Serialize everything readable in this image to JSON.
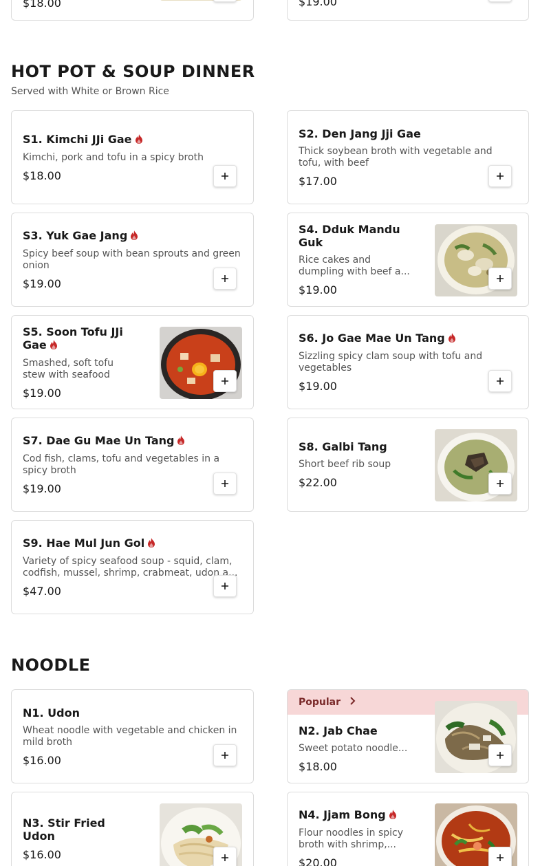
{
  "top_partial": {
    "left_price": "$18.00",
    "right_price": "$19.00"
  },
  "hotpot": {
    "title": "HOT POT & SOUP DINNER",
    "subtitle": "Served with White or Brown Rice",
    "items": [
      {
        "name": "S1. Kimchi JJi Gae",
        "desc": "Kimchi, pork and tofu in a spicy broth",
        "price": "$18.00",
        "spicy": true
      },
      {
        "name": "S2. Den Jang Jji Gae",
        "desc": "Thick soybean broth with vegetable and tofu, with beef",
        "price": "$17.00",
        "spicy": false
      },
      {
        "name": "S3. Yuk Gae Jang",
        "desc": "Spicy beef soup with bean sprouts and green onion",
        "price": "$19.00",
        "spicy": true
      },
      {
        "name": "S4. Dduk Mandu Guk",
        "desc": "Rice cakes and dumpling with beef a...",
        "price": "$19.00",
        "spicy": false,
        "image": "dumpling-soup"
      },
      {
        "name": "S5. Soon Tofu JJi Gae",
        "desc": "Smashed, soft tofu stew with seafood",
        "price": "$19.00",
        "spicy": true,
        "image": "tofu-stew"
      },
      {
        "name": "S6. Jo Gae Mae Un Tang",
        "desc": "Sizzling spicy clam soup with tofu and vegetables",
        "price": "$19.00",
        "spicy": true
      },
      {
        "name": "S7. Dae Gu Mae Un Tang",
        "desc": "Cod fish, clams, tofu and vegetables in a spicy broth",
        "price": "$19.00",
        "spicy": true
      },
      {
        "name": "S8. Galbi Tang",
        "desc": "Short beef rib soup",
        "price": "$22.00",
        "spicy": false,
        "image": "rib-soup"
      },
      {
        "name": "S9. Hae Mul Jun Gol",
        "desc": "Variety of spicy seafood soup - squid, clam, codfish, mussel, shrimp, crabmeat, udon a...",
        "price": "$47.00",
        "spicy": true
      }
    ]
  },
  "noodle": {
    "title": "NOODLE",
    "popular_label": "Popular",
    "items": [
      {
        "name": "N1. Udon",
        "desc": "Wheat noodle with vegetable and chicken in mild broth",
        "price": "$16.00",
        "spicy": false
      },
      {
        "name": "N2. Jab Chae",
        "desc": "Sweet potato noodle...",
        "price": "$18.00",
        "spicy": false,
        "image": "japchae",
        "popular": true
      },
      {
        "name": "N3. Stir Fried Udon",
        "desc": "",
        "price": "$16.00",
        "spicy": false,
        "image": "stir-fried-udon"
      },
      {
        "name": "N4. Jjam Bong",
        "desc": "Flour noodles in spicy broth with shrimp,...",
        "price": "$20.00",
        "spicy": true,
        "image": "jjambong"
      }
    ]
  },
  "icons": {
    "spicy": "flame-icon",
    "add": "plus-icon",
    "popular_arrow": "chevron-right-icon"
  },
  "colors": {
    "spicy": "#c62828",
    "popular_bg": "#f7d7d7",
    "border": "#dcdcdc"
  }
}
